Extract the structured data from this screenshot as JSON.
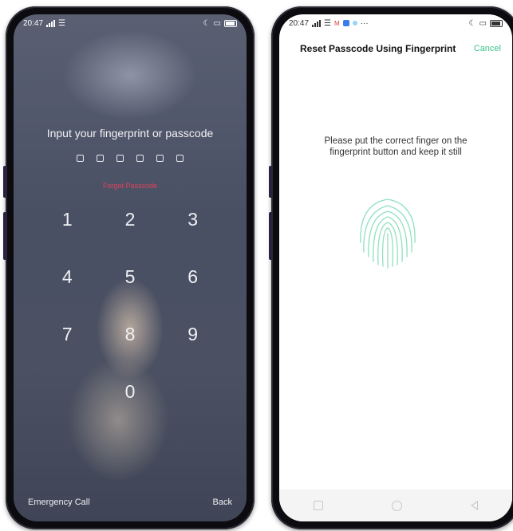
{
  "lock_screen": {
    "status": {
      "time": "20:47"
    },
    "prompt": "Input your fingerprint or passcode",
    "passcode_slots": 6,
    "forgot_label": "Forgot Passcode",
    "keys": [
      "1",
      "2",
      "3",
      "4",
      "5",
      "6",
      "7",
      "8",
      "9",
      "0"
    ],
    "emergency_label": "Emergency Call",
    "back_label": "Back"
  },
  "reset_screen": {
    "status": {
      "time": "20:47",
      "extra": "···"
    },
    "title": "Reset Passcode Using Fingerprint",
    "cancel_label": "Cancel",
    "instructions": "Please put the correct finger on the fingerprint button and keep it still",
    "fingerprint_icon": "fingerprint-icon",
    "accent_color": "#3cc38a"
  },
  "colors": {
    "forgot": "#e0425a",
    "fingerprint": "#8fe0c0"
  }
}
